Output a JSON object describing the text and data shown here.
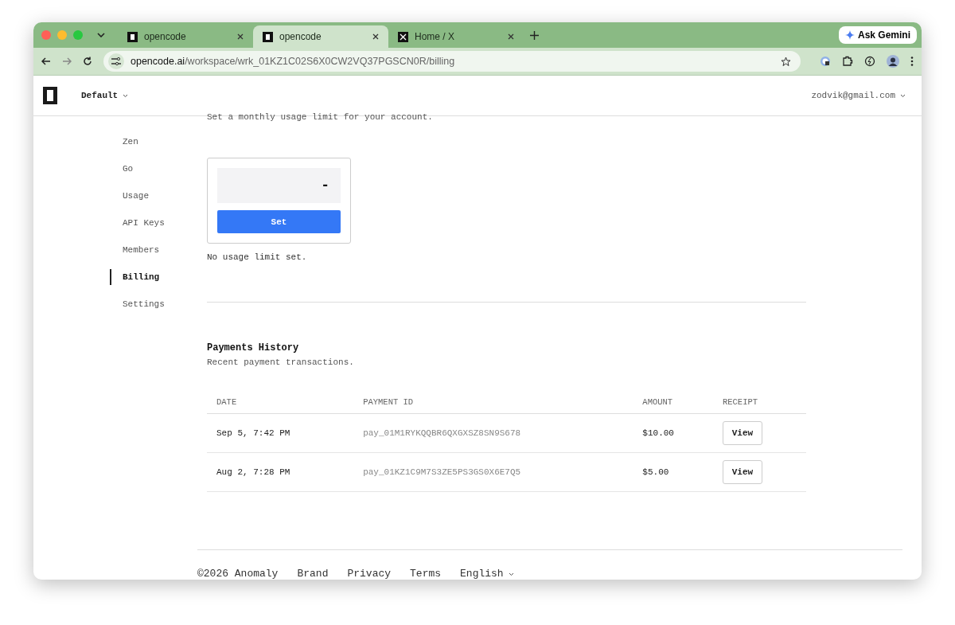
{
  "browser": {
    "tabs": [
      {
        "title": "opencode",
        "kind": "square",
        "selected": false
      },
      {
        "title": "opencode",
        "kind": "square",
        "selected": true
      },
      {
        "title": "Home / X",
        "kind": "x",
        "selected": false
      }
    ],
    "gemini": "Ask Gemini",
    "url_host": "opencode.ai",
    "url_path": "/workspace/wrk_01KZ1C02S6X0CW2VQ37PGSCN0R/billing"
  },
  "header": {
    "workspace": "Default",
    "account": "zodvik@gmail.com"
  },
  "sidebar": {
    "items": [
      {
        "label": "Zen",
        "selected": false
      },
      {
        "label": "Go",
        "selected": false
      },
      {
        "label": "Usage",
        "selected": false
      },
      {
        "label": "API Keys",
        "selected": false
      },
      {
        "label": "Members",
        "selected": false
      },
      {
        "label": "Billing",
        "selected": true
      },
      {
        "label": "Settings",
        "selected": false
      }
    ]
  },
  "usage_limit": {
    "description": "Set a monthly usage limit for your account.",
    "value": "-",
    "button": "Set",
    "status": "No usage limit set."
  },
  "payments": {
    "title": "Payments History",
    "subtitle": "Recent payment transactions.",
    "columns": [
      "DATE",
      "PAYMENT ID",
      "AMOUNT",
      "RECEIPT"
    ],
    "rows": [
      {
        "date": "Sep 5, 7:42 PM",
        "id": "pay_01M1RYKQQBR6QXGXSZ8SN9S678",
        "amount": "$10.00",
        "action": "View"
      },
      {
        "date": "Aug 2, 7:28 PM",
        "id": "pay_01KZ1C9M7S3ZE5PS3GS0X6E7Q5",
        "amount": "$5.00",
        "action": "View"
      }
    ]
  },
  "footer": {
    "copyright": "©2026 Anomaly",
    "links": [
      "Brand",
      "Privacy",
      "Terms"
    ],
    "language": "English"
  }
}
